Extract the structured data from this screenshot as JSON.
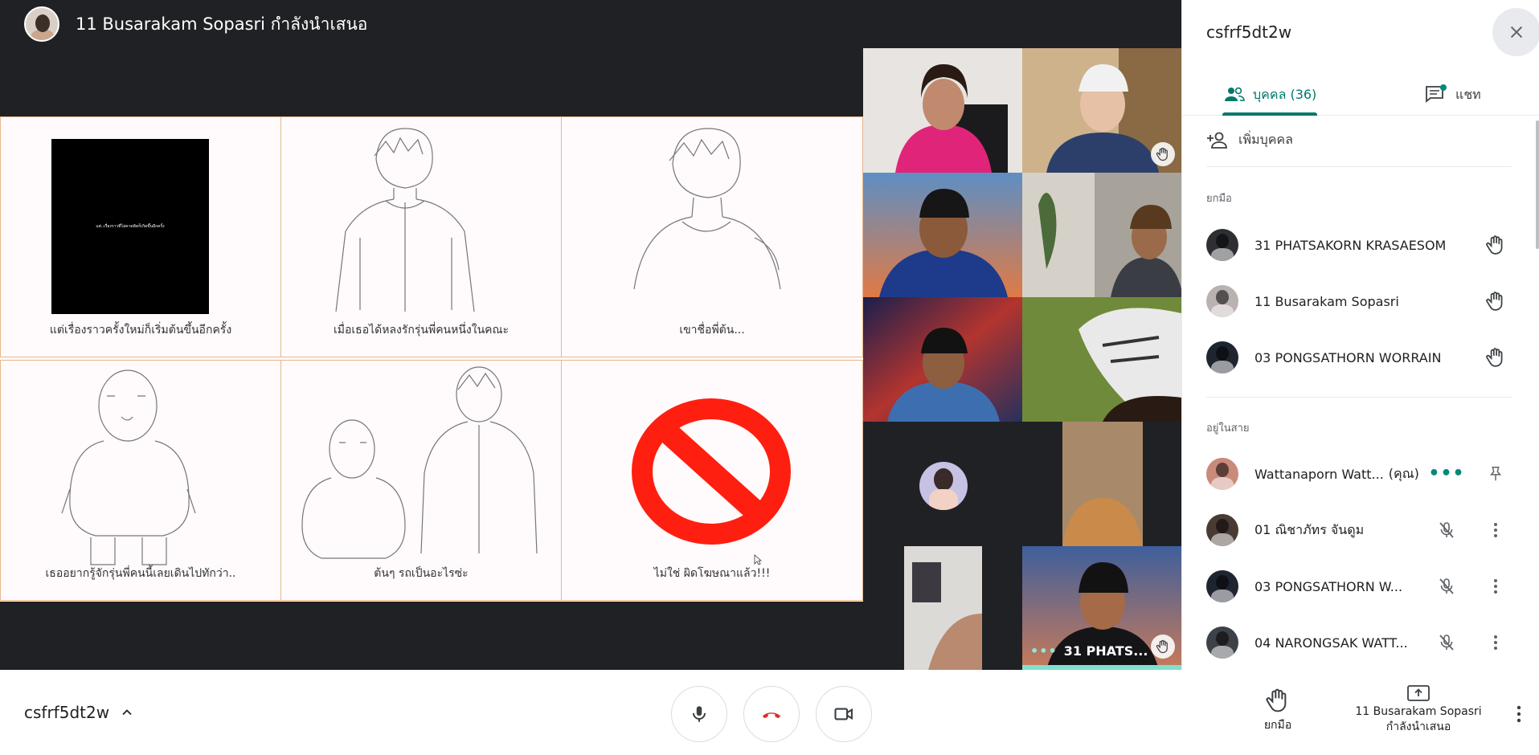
{
  "presenter": {
    "title": "11 Busarakam Sopasri กำลังนำเสนอ"
  },
  "slide": {
    "black_card_text": "แต่..เรื่องราวที่ไม่คาดคิดก็เกิดขึ้นอีกครั้ง",
    "captions": [
      "แต่เรื่องราวครั้งใหม่ก็เริ่มต้นขึ้นอีกครั้ง",
      "เมื่อเธอได้หลงรักรุ่นพี่คนหนึ่งในคณะ",
      "เขาชื่อพี่ต้น...",
      "เธออยากรู้จักรุ่นพี่คนนี้เลยเดินไปทักว่า..",
      "ต้นๆ รถเป็นอะไรซ่ะ",
      "ไม่ใช่  ผิดโฆษณาแล้ว!!!"
    ]
  },
  "tiles": {
    "bottom_right_label": "31 PHATS..."
  },
  "bottom_bar": {
    "meeting_code": "csfrf5dt2w"
  },
  "side_panel": {
    "title": "csfrf5dt2w",
    "tab_people": "บุคคล (36)",
    "tab_chat": "แชท",
    "add_people": "เพิ่มบุคคล",
    "section_raised": "ยกมือ",
    "section_in_call": "อยู่ในสาย",
    "raised": [
      {
        "name": "31 PHATSAKORN KRASAESOM",
        "color": "#2e2f33"
      },
      {
        "name": "11 Busarakam Sopasri",
        "color": "#b9b2b0"
      },
      {
        "name": "03 PONGSATHORN WORRAIN",
        "color": "#1f2530"
      }
    ],
    "in_call": [
      {
        "name": "Wattanaporn Watt...",
        "you": "(คุณ)",
        "color": "#c98a7a"
      },
      {
        "name": "01 ณิชาภัทร จันดูม",
        "color": "#4a3a34"
      },
      {
        "name": "03 PONGSATHORN W...",
        "color": "#1f2530"
      },
      {
        "name": "04 NARONGSAK WATT...",
        "color": "#3d4248"
      }
    ]
  },
  "side_bottom": {
    "raise_hand": "ยกมือ",
    "presenting_line1": "11 Busarakam Sopasri",
    "presenting_line2": "กำลังนำเสนอ"
  },
  "colors": {
    "accent": "#00796b",
    "hangup": "#d93025",
    "dark_bg": "#202124"
  }
}
